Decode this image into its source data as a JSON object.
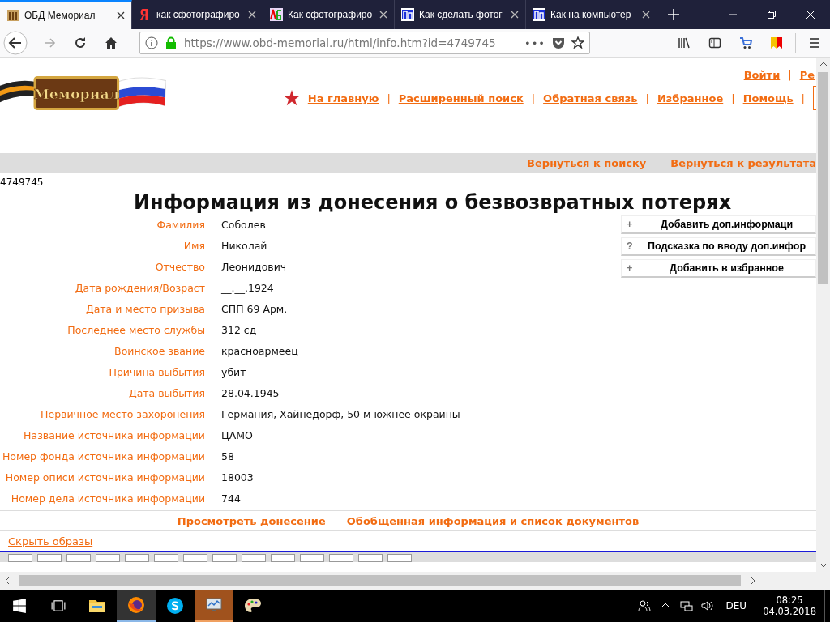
{
  "browser": {
    "tabs": [
      {
        "title": "ОБД Мемориал",
        "selected": true,
        "kind": "memorial"
      },
      {
        "title": "как сфотографиро",
        "selected": false,
        "kind": "yandex"
      },
      {
        "title": "Как сфотографиро",
        "selected": false,
        "kind": "abc"
      },
      {
        "title": "Как сделать фотог",
        "selected": false,
        "kind": "pp"
      },
      {
        "title": "Как на компьютер",
        "selected": false,
        "kind": "pp"
      }
    ],
    "url_host": "https://www.obd-memorial.ru",
    "url_path": "/html/info.htm?id=4749745",
    "dots": "•••"
  },
  "site": {
    "logo_text": "Мемориал",
    "account_links": [
      {
        "kind": "link",
        "text": "Войти"
      },
      {
        "kind": "separator",
        "text": "|"
      },
      {
        "kind": "link",
        "text": "Ре"
      }
    ],
    "nav": [
      {
        "kind": "link",
        "text": "На главную"
      },
      {
        "kind": "separator",
        "text": "|"
      },
      {
        "kind": "link",
        "text": "Расширенный поиск"
      },
      {
        "kind": "separator",
        "text": "|"
      },
      {
        "kind": "link",
        "text": "Обратная связь"
      },
      {
        "kind": "separator",
        "text": "|"
      },
      {
        "kind": "link",
        "text": "Избранное"
      },
      {
        "kind": "separator",
        "text": "|"
      },
      {
        "kind": "link",
        "text": "Помощь"
      },
      {
        "kind": "separator",
        "text": "|"
      }
    ],
    "back_links": [
      "Вернуться к поиску",
      "Вернуться к результата"
    ]
  },
  "record": {
    "id": "4749745",
    "title": "Информация из донесения о безвозвратных потерях",
    "fields": [
      {
        "label": "Фамилия",
        "value": "Соболев"
      },
      {
        "label": "Имя",
        "value": "Николай"
      },
      {
        "label": "Отчество",
        "value": "Леонидович"
      },
      {
        "label": "Дата рождения/Возраст",
        "value": "__.__.1924"
      },
      {
        "label": "Дата и место призыва",
        "value": "СПП 69 Арм."
      },
      {
        "label": "Последнее место службы",
        "value": "312 сд"
      },
      {
        "label": "Воинское звание",
        "value": "красноармеец"
      },
      {
        "label": "Причина выбытия",
        "value": "убит"
      },
      {
        "label": "Дата выбытия",
        "value": "28.04.1945"
      },
      {
        "label": "Первичное место захоронения",
        "value": "Германия, Хайнедорф, 50 м южнее окраины"
      },
      {
        "label": "Название источника информации",
        "value": "ЦАМО"
      },
      {
        "label": "Номер фонда источника информации",
        "value": "58"
      },
      {
        "label": "Номер описи источника информации",
        "value": "18003"
      },
      {
        "label": "Номер дела источника информации",
        "value": "744"
      }
    ],
    "actions": [
      {
        "sign": "+",
        "label": "Добавить доп.информаци"
      },
      {
        "sign": "?",
        "label": "Подсказка по вводу доп.инфор"
      },
      {
        "sign": "+",
        "label": "Добавить в избранное"
      }
    ],
    "bottom_links": [
      "Просмотреть донесение",
      "Обобщенная информация и список документов"
    ],
    "hide_images": "Скрыть образы"
  },
  "taskbar": {
    "apps": [
      {
        "kind": "folder",
        "selected": false
      },
      {
        "kind": "firefox",
        "selected": true
      },
      {
        "kind": "skype",
        "selected": false
      },
      {
        "kind": "monitor",
        "selected": true
      },
      {
        "kind": "paint",
        "selected": false
      }
    ],
    "lang": "DEU",
    "time": "08:25",
    "date": "04.03.2018"
  }
}
